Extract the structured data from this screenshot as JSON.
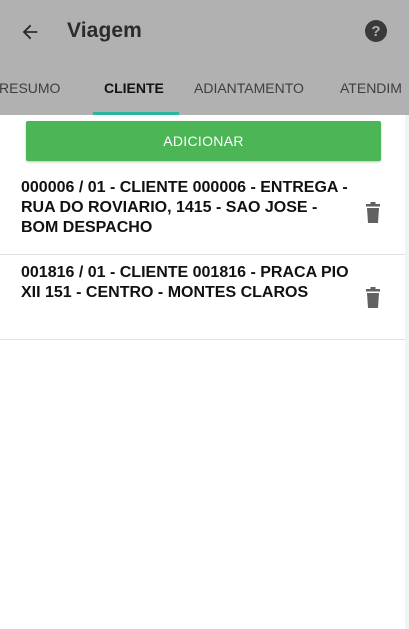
{
  "toolbar": {
    "title": "Viagem",
    "back_icon": "arrow-left-icon",
    "help_icon": "help-circle-icon"
  },
  "tabs": [
    {
      "label": "RESUMO",
      "active": false
    },
    {
      "label": "CLIENTE",
      "active": true
    },
    {
      "label": "ADIANTAMENTO",
      "active": false
    },
    {
      "label": "ATENDIM",
      "active": false
    }
  ],
  "add_button": {
    "label": "ADICIONAR"
  },
  "items": [
    {
      "text": "000006 / 01 - CLIENTE 000006 - ENTREGA - RUA DO ROVIARIO, 1415 - SAO JOSE - BOM DESPACHO",
      "action_icon": "trash-icon"
    },
    {
      "text": "001816 / 01 - CLIENTE 001816 - PRACA PIO XII 151 - CENTRO - MONTES CLAROS",
      "action_icon": "trash-icon"
    }
  ],
  "colors": {
    "appbar": "#b1b1b1",
    "accent": "#2bb6a0",
    "button": "#4cb556"
  }
}
